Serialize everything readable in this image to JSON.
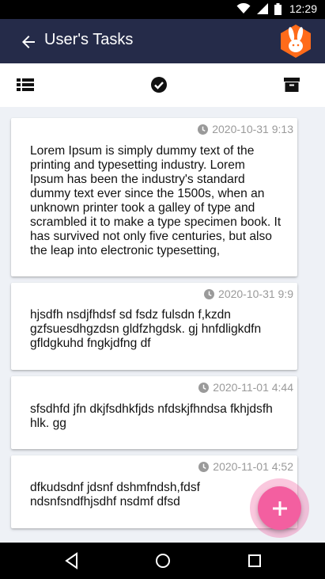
{
  "status_bar": {
    "time": "12:29"
  },
  "app_bar": {
    "title": "User's Tasks"
  },
  "toolbar": {
    "icons": [
      "list-icon",
      "check-circle-icon",
      "archive-icon"
    ]
  },
  "tasks": [
    {
      "time": "2020-10-31 9:13",
      "text": "Lorem Ipsum is simply dummy text of the printing and typesetting industry. Lorem Ipsum has been the industry's standard dummy text ever since the 1500s, when an unknown printer took a galley of type and scrambled it to make a type specimen book. It has survived not only five centuries, but also the leap into electronic typesetting,"
    },
    {
      "time": "2020-10-31 9:9",
      "text": "hjsdfh nsdjfhdsf sd fsdz fulsdn f,kzdn gzfsuesdhgzdsn gldfzhgdsk. gj hnfdligkdfn gfldgkuhd fngkjdfng df"
    },
    {
      "time": "2020-11-01 4:44",
      "text": "sfsdhfd jfn dkjfsdhkfjds nfdskjfhndsa fkhjdsfh hlk. gg"
    },
    {
      "time": "2020-11-01 4:52",
      "text": "dfkudsdnf jdsnf dshmfndsh,fdsf ndsnfsndfhjsdhf nsdmf dfsd"
    }
  ],
  "fab": {
    "icon": "plus-icon"
  },
  "colors": {
    "app_bar": "#252b49",
    "accent": "#f35fa0",
    "logo": "#ff6b1a"
  }
}
